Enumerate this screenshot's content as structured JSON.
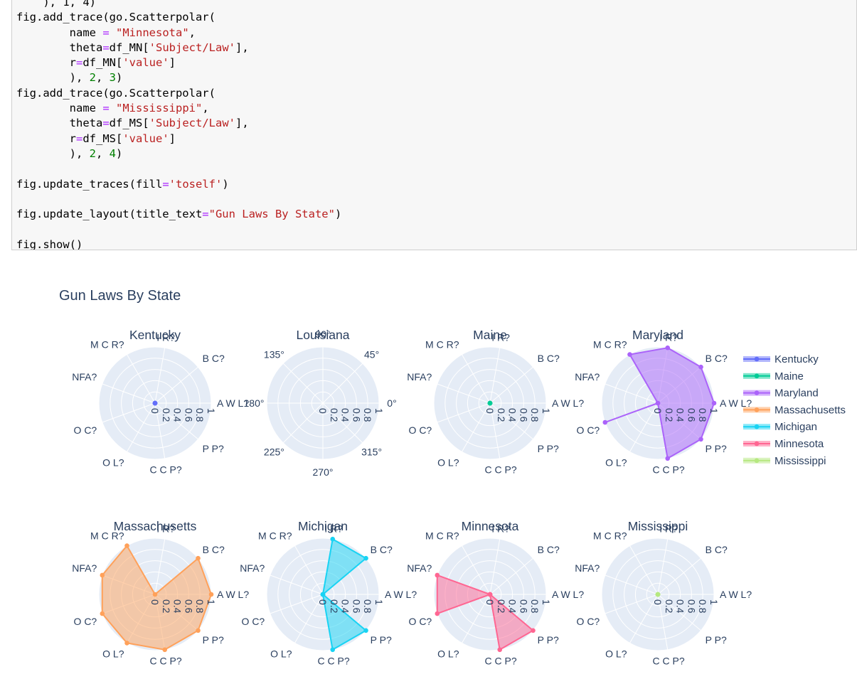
{
  "code_cell": {
    "lines": [
      [
        {
          "t": "    ), 1, 4)"
        }
      ],
      [
        {
          "t": "fig.add_trace(go.Scatterpolar("
        }
      ],
      [
        {
          "t": "        name "
        },
        {
          "t": "=",
          "c": "op"
        },
        {
          "t": " "
        },
        {
          "t": "\"Minnesota\"",
          "c": "str"
        },
        {
          "t": ","
        }
      ],
      [
        {
          "t": "        theta"
        },
        {
          "t": "=",
          "c": "op"
        },
        {
          "t": "df_MN["
        },
        {
          "t": "'Subject/Law'",
          "c": "str"
        },
        {
          "t": "],"
        }
      ],
      [
        {
          "t": "        r"
        },
        {
          "t": "=",
          "c": "op"
        },
        {
          "t": "df_MN["
        },
        {
          "t": "'value'",
          "c": "str"
        },
        {
          "t": "]"
        }
      ],
      [
        {
          "t": "        ), "
        },
        {
          "t": "2",
          "c": "num"
        },
        {
          "t": ", "
        },
        {
          "t": "3",
          "c": "num"
        },
        {
          "t": ")"
        }
      ],
      [
        {
          "t": "fig.add_trace(go.Scatterpolar("
        }
      ],
      [
        {
          "t": "        name "
        },
        {
          "t": "=",
          "c": "op"
        },
        {
          "t": " "
        },
        {
          "t": "\"Mississippi\"",
          "c": "str"
        },
        {
          "t": ","
        }
      ],
      [
        {
          "t": "        theta"
        },
        {
          "t": "=",
          "c": "op"
        },
        {
          "t": "df_MS["
        },
        {
          "t": "'Subject/Law'",
          "c": "str"
        },
        {
          "t": "],"
        }
      ],
      [
        {
          "t": "        r"
        },
        {
          "t": "=",
          "c": "op"
        },
        {
          "t": "df_MS["
        },
        {
          "t": "'value'",
          "c": "str"
        },
        {
          "t": "]"
        }
      ],
      [
        {
          "t": "        ), "
        },
        {
          "t": "2",
          "c": "num"
        },
        {
          "t": ", "
        },
        {
          "t": "4",
          "c": "num"
        },
        {
          "t": ")"
        }
      ],
      [
        {
          "t": ""
        }
      ],
      [
        {
          "t": "fig.update_traces(fill"
        },
        {
          "t": "=",
          "c": "op"
        },
        {
          "t": "'toself'",
          "c": "str"
        },
        {
          "t": ")"
        }
      ],
      [
        {
          "t": ""
        }
      ],
      [
        {
          "t": "fig.update_layout(title_text"
        },
        {
          "t": "=",
          "c": "op"
        },
        {
          "t": "\"Gun Laws By State\"",
          "c": "str"
        },
        {
          "t": ")"
        }
      ],
      [
        {
          "t": ""
        }
      ],
      [
        {
          "t": "fig.show()"
        }
      ]
    ]
  },
  "colors": {
    "code_bg": "#f7f7f7",
    "code_border": "#cfcfcf",
    "polar_bg": "#e5ecf6",
    "text": "#2a3f5f"
  },
  "chart_data": {
    "type": "polar",
    "title": "Gun Laws By State",
    "radial_range": [
      0,
      1
    ],
    "radial_ticks": [
      "0",
      "0.2",
      "0.4",
      "0.6",
      "0.8",
      "1"
    ],
    "angular_ticks_empty": [
      "90°",
      "45°",
      "0°",
      "315°",
      "270°",
      "225°",
      "180°",
      "135°"
    ],
    "legend_position": "right",
    "subplots": [
      {
        "title": "Kentucky",
        "trace": "Kentucky"
      },
      {
        "title": "Louisiana",
        "trace": null
      },
      {
        "title": "Maine",
        "trace": "Maine"
      },
      {
        "title": "Maryland",
        "trace": "Maryland"
      },
      {
        "title": "Massachusetts",
        "trace": "Massachusetts"
      },
      {
        "title": "Michigan",
        "trace": "Michigan"
      },
      {
        "title": "Minnesota",
        "trace": "Minnesota"
      },
      {
        "title": "Mississippi",
        "trace": "Mississippi"
      }
    ],
    "categories": [
      "A W L?",
      "B C?",
      "I R?",
      "M C R?",
      "NFA?",
      "O C?",
      "O L?",
      "C C P?",
      "P P?"
    ],
    "series": [
      {
        "name": "Kentucky",
        "color": "#636efa",
        "values": [
          0,
          0,
          0,
          0,
          0,
          0,
          0,
          0,
          0
        ]
      },
      {
        "name": "Maine",
        "color": "#00cc96",
        "values": [
          0,
          0,
          0,
          0,
          0,
          0,
          0,
          0,
          0
        ]
      },
      {
        "name": "Maryland",
        "color": "#ab63fa",
        "values": [
          1,
          1,
          1,
          1,
          0,
          1,
          0,
          1,
          1
        ]
      },
      {
        "name": "Massachusetts",
        "color": "#ffa15a",
        "values": [
          1,
          1,
          0,
          1,
          1,
          1,
          1,
          1,
          1
        ]
      },
      {
        "name": "Michigan",
        "color": "#19d3f3",
        "values": [
          0,
          1,
          1,
          0,
          0,
          0,
          0,
          1,
          1
        ]
      },
      {
        "name": "Minnesota",
        "color": "#ff6692",
        "values": [
          0,
          0,
          0,
          0,
          1,
          1,
          0,
          1,
          1
        ]
      },
      {
        "name": "Mississippi",
        "color": "#b6e880",
        "values": [
          0,
          0,
          0,
          0,
          0,
          0,
          0,
          0,
          0
        ]
      }
    ]
  }
}
